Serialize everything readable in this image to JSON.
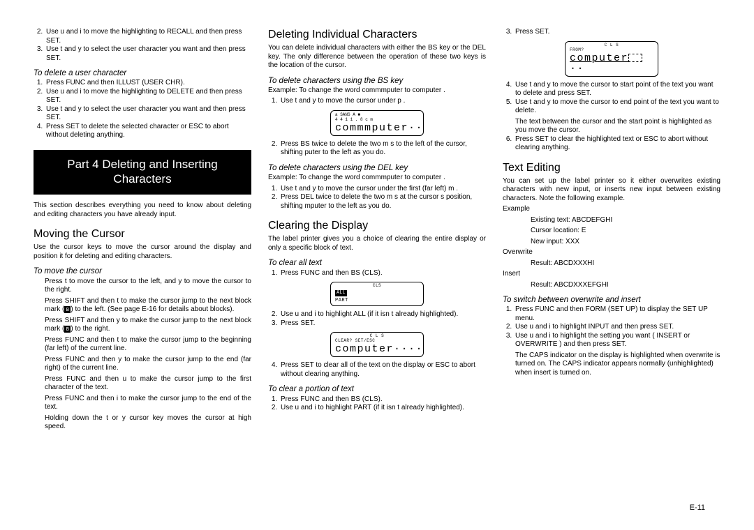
{
  "col1": {
    "step2": "Use u and i to move the highlighting to RECALL and then press SET.",
    "step3": "Use t and y to select the user character you want and then press SET.",
    "sub_del_user": "To delete a user character",
    "del1": "Press FUNC and then ILLUST (USER CHR).",
    "del2": "Use u and i to move the highlighting to DELETE and then press SET.",
    "del3": "Use t and y to select the user character you want and then press SET.",
    "del4": "Press SET to delete the selected character or ESC to abort without deleting anything.",
    "part_banner": "Part 4  Deleting and Inserting Characters",
    "intro": "This section describes everything you need to know about deleting and editing characters you have already input.",
    "sec_move": "Moving the Cursor",
    "move_intro": "Use the cursor keys to move the cursor around the display and position it for deleting and editing characters.",
    "sub_move": "To move the cursor",
    "mv1a": "Press t to move the cursor to the left, and y to move the cursor to the right.",
    "mv2a": "Press SHIFT and then t to make the cursor jump to the next block mark (",
    "mv2b": ") to the left. (See page E-16 for details about blocks).",
    "mv3a": "Press SHIFT and then y to make the cursor jump to the next block mark (",
    "mv3b": ") to the right.",
    "mv4": "Press FUNC and then t to make the cursor jump to the beginning (far left) of the current line.",
    "mv5": "Press FUNC and then y to make the cursor jump to the end (far right) of the current line.",
    "mv6": "Press FUNC and then u to make the cursor jump to the first character of the text.",
    "mv7": "Press FUNC and then i to make the cursor jump to the end of the text.",
    "mv8": "Holding down the t or y cursor key moves the cursor at high speed."
  },
  "col2": {
    "sec_del_indiv": "Deleting Individual Characters",
    "del_intro": "You can delete individual characters with either the BS key or the DEL key. The only difference between the operation of these two keys is the location of the cursor.",
    "sub_bs": "To delete characters using the BS key",
    "bs_ex": "Example: To change the word  commmputer  to  computer .",
    "bs1": "Use t and y to move the cursor under  p .",
    "lcd1_top": "a SANS       A  ■",
    "lcd1_bot": "4   4      1 1 . 8 c m",
    "lcd1_big": "commmputer··",
    "bs2": "Press BS twice to delete the two m s to the left of the cursor, shifting  puter  to the left as you do.",
    "sub_del": "To delete characters using the DEL key",
    "del_ex": "Example: To change the word  commmputer  to  computer .",
    "dl1": "Use t and y to move the cursor under the first (far left)  m .",
    "dl2": "Press DEL twice to delete the two m s at the cursor s position, shifting  mputer  to the left as you do.",
    "sec_clear": "Clearing the Display",
    "clear_intro": "The label printer gives you a choice of clearing the entire display or only a specific block of text.",
    "sub_clear_all": "To clear all text",
    "ca1": "Press FUNC and then BS (CLS).",
    "lcd2_top": "CLS",
    "lcd2_all": "ALL",
    "lcd2_part": "PART",
    "ca2": "Use u and i to highlight  ALL  (if it isn t already highlighted).",
    "ca3": "Press SET.",
    "lcd3_top": "C L S",
    "lcd3_mid": "CLEAR?    SET/ESC",
    "lcd3_big": "computer····",
    "ca4": "Press SET to clear all of the text on the display or ESC to abort without clearing anything.",
    "sub_clear_portion": "To clear a portion of text",
    "cp1": "Press FUNC and then BS (CLS).",
    "cp2": "Use u and i to highlight  PART  (if it isn t already highlighted)."
  },
  "col3": {
    "step3": "Press SET.",
    "lcd4_top": "C L S",
    "lcd4_mid": "FROM?",
    "lcd4_big": "computer",
    "pt4": "Use t and y to move the cursor to start point of the text you want to delete and press SET.",
    "pt5": "Use t and y to move the cursor to end point of the text you want to delete.",
    "pt5b": "The text between the cursor and the start point is highlighted as you move the cursor.",
    "pt6": "Press SET to clear the highlighted text or ESC to abort without clearing anything.",
    "sec_edit": "Text Editing",
    "edit_intro": "You can set up the label printer so it either overwrites existing characters with new input, or inserts new input between existing characters. Note the following example.",
    "ex_label": "Example",
    "ex1": "Existing text: ABCDEFGHI",
    "ex2": "Cursor location: E",
    "ex3": "New input: XXX",
    "ov_label": "Overwrite",
    "ov1": "Result: ABCDXXXHI",
    "ins_label": "Insert",
    "ins1": "Result: ABCDXXXEFGHI",
    "sub_switch": "To switch between overwrite and insert",
    "sw1": "Press FUNC and then FORM (SET UP) to display the SET UP menu.",
    "sw2": "Use u and i to highlight  INPUT  and then press SET.",
    "sw3": "Use u and i to highlight the setting you want ( INSERT  or  OVERWRITE ) and then press SET.",
    "sw_note": "The CAPS indicator on the display is highlighted when overwrite is turned on. The CAPS indicator appears normally (unhighlighted) when insert is turned on."
  },
  "page_no": "E-11"
}
